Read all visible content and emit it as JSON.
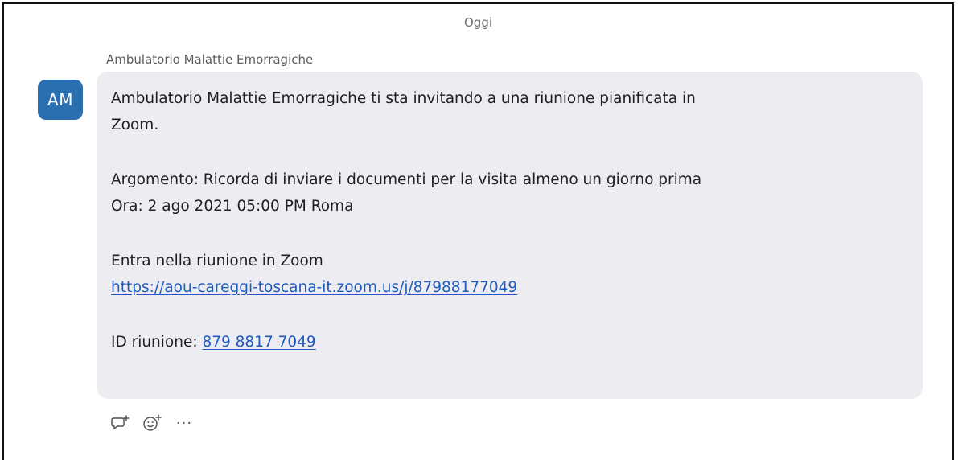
{
  "date_separator": "Oggi",
  "message": {
    "sender_name": "Ambulatorio Malattie Emorragiche",
    "avatar_initials": "AM",
    "avatar_color": "#2a6fb0",
    "bubble_color": "#ededf1",
    "lines": {
      "intro_1": "Ambulatorio Malattie Emorragiche ti sta invitando a una riunione pianificata in",
      "intro_2": "Zoom.",
      "topic": "Argomento: Ricorda di inviare i documenti per la visita almeno un giorno prima",
      "time": "Ora: 2 ago 2021 05:00 PM Roma",
      "join_label": "Entra nella riunione in Zoom",
      "join_link": "https://aou-careggi-toscana-it.zoom.us/j/87988177049",
      "meeting_id_label": "ID riunione: ",
      "meeting_id_value": "879 8817 7049"
    },
    "link_color": "#1f5bbf"
  },
  "actions": {
    "reply_icon": "reply-thread-icon",
    "react_icon": "add-reaction-icon",
    "more_label": "···"
  }
}
